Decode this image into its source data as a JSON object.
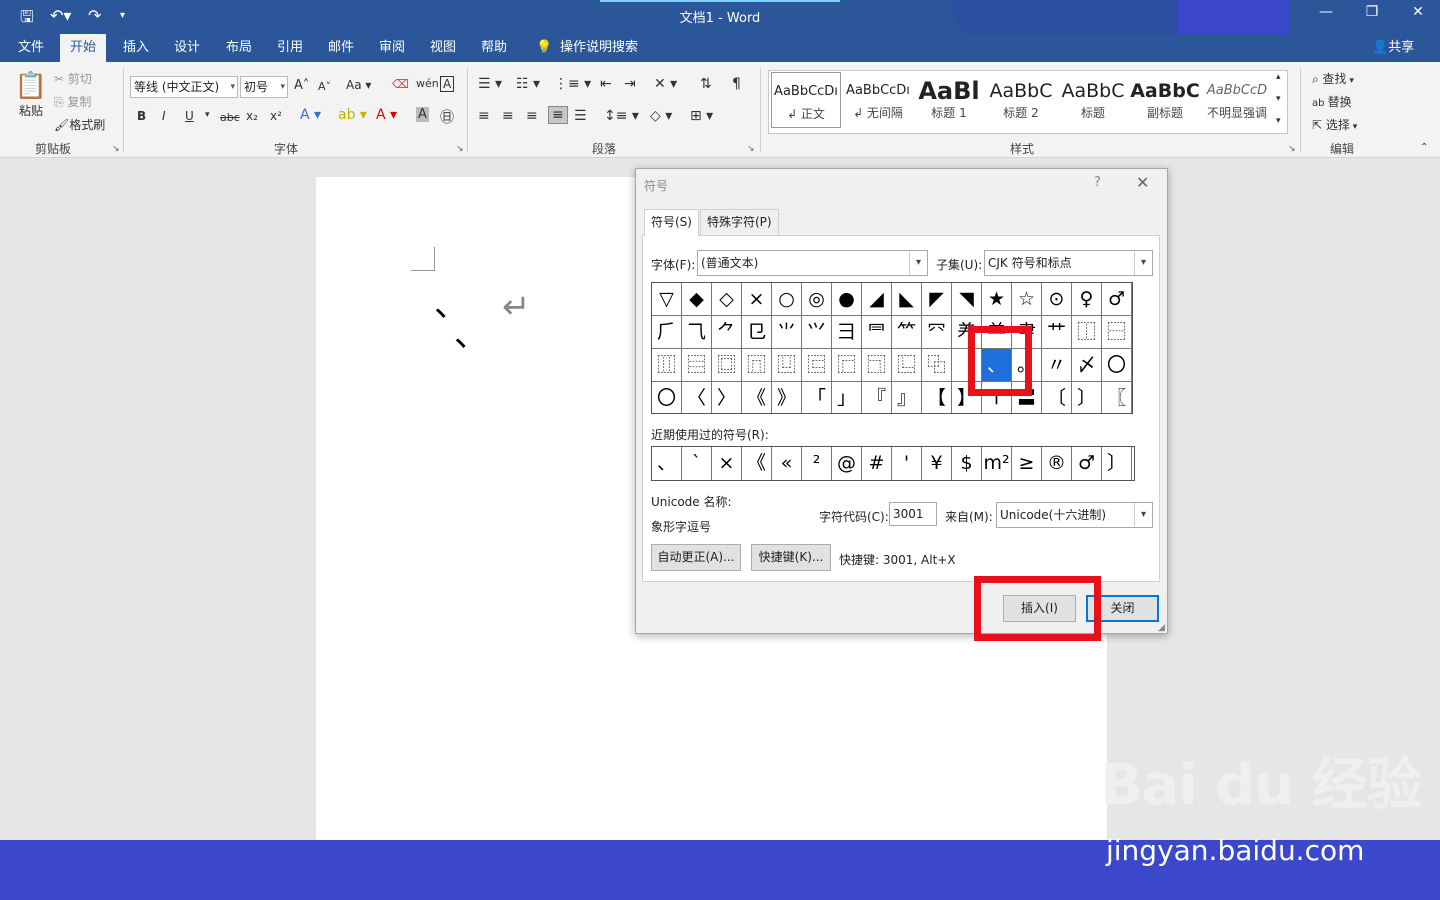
{
  "window": {
    "title": "文档1  -  Word",
    "quick_access": [
      "save-icon",
      "undo-icon",
      "redo-icon",
      "customize-icon"
    ],
    "controls": [
      "minimize-icon",
      "restore-icon",
      "close-icon"
    ]
  },
  "ribbon_tabs": [
    "文件",
    "开始",
    "插入",
    "设计",
    "布局",
    "引用",
    "邮件",
    "审阅",
    "视图",
    "帮助",
    "操作说明搜索"
  ],
  "share_label": "共享",
  "clipboard": {
    "paste": "粘贴",
    "cut": "剪切",
    "copy": "复制",
    "format_painter": "格式刷",
    "group": "剪贴板"
  },
  "font": {
    "name": "等线 (中文正文)",
    "size": "初号",
    "group": "字体",
    "buttons": [
      "B",
      "I",
      "U",
      "abc",
      "x₂",
      "x²"
    ]
  },
  "paragraph": {
    "group": "段落"
  },
  "styles": {
    "group": "样式",
    "items": [
      {
        "sample": "AaBbCcDı",
        "name": "↲ 正文"
      },
      {
        "sample": "AaBbCcDı",
        "name": "↲ 无间隔"
      },
      {
        "sample": "AaBl",
        "name": "标题 1"
      },
      {
        "sample": "AaBbC",
        "name": "标题 2"
      },
      {
        "sample": "AaBbC",
        "name": "标题"
      },
      {
        "sample": "AaBbC",
        "name": "副标题"
      },
      {
        "sample": "AaBbCcD",
        "name": "不明显强调"
      }
    ]
  },
  "editing": {
    "find": "查找",
    "replace": "替换",
    "select": "选择",
    "group": "编辑"
  },
  "document": {
    "chars": [
      "、",
      "、"
    ],
    "para_mark": "↵"
  },
  "dialog": {
    "title": "符号",
    "help": "?",
    "close": "✕",
    "tabs": [
      "符号(S)",
      "特殊字符(P)"
    ],
    "font_label": "字体(F):",
    "font_value": "(普通文本)",
    "subset_label": "子集(U):",
    "subset_value": "CJK 符号和标点",
    "grid": [
      [
        "▽",
        "◆",
        "◇",
        "×",
        "○",
        "◎",
        "●",
        "◢",
        "◣",
        "◤",
        "◥",
        "★",
        "☆",
        "⊙",
        "♀",
        "♂"
      ],
      [
        "⺁",
        "⺄",
        "⺈",
        "⺋",
        "⺌",
        "⺍",
        "⺕",
        "⺜",
        "⺮",
        "⺳",
        "⺶",
        "⺷",
        "⺻",
        "⺾",
        "⿰",
        "⿱"
      ],
      [
        "⿲",
        "⿳",
        "⿴",
        "⿵",
        "⿶",
        "⿷",
        "⿸",
        "⿹",
        "⿺",
        "⿻",
        "",
        "、",
        "。",
        "〃",
        "〆",
        "〇"
      ],
      [
        "〇",
        "〈",
        "〉",
        "《",
        "》",
        "「",
        "」",
        "『",
        "』",
        "【",
        "】",
        "〒",
        "〓",
        "〔",
        "〕",
        "〖"
      ]
    ],
    "selected_cell": "、",
    "recent_label": "近期使用过的符号(R):",
    "recent": [
      "、",
      "`",
      "×",
      "《",
      "«",
      "²",
      "@",
      "#",
      "'",
      "¥",
      "$",
      "m²",
      "≥",
      "®",
      "♂",
      "〕"
    ],
    "unicode_name_label": "Unicode 名称:",
    "unicode_name": "象形字逗号",
    "char_code_label": "字符代码(C):",
    "char_code": "3001",
    "from_label": "来自(M):",
    "from_value": "Unicode(十六进制)",
    "autocorrect_button": "自动更正(A)...",
    "shortcut_button": "快捷键(K)...",
    "shortcut_text": "快捷键: 3001, Alt+X",
    "insert_button": "插入(I)",
    "close_button": "关闭"
  },
  "watermark": {
    "logo": "Bai du 经验",
    "url": "jingyan.baidu.com"
  },
  "colors": {
    "word_blue": "#2b579a",
    "highlight_red": "#e8101b",
    "selection_blue": "#1e6fd9",
    "band_blue": "#3b48cc"
  }
}
